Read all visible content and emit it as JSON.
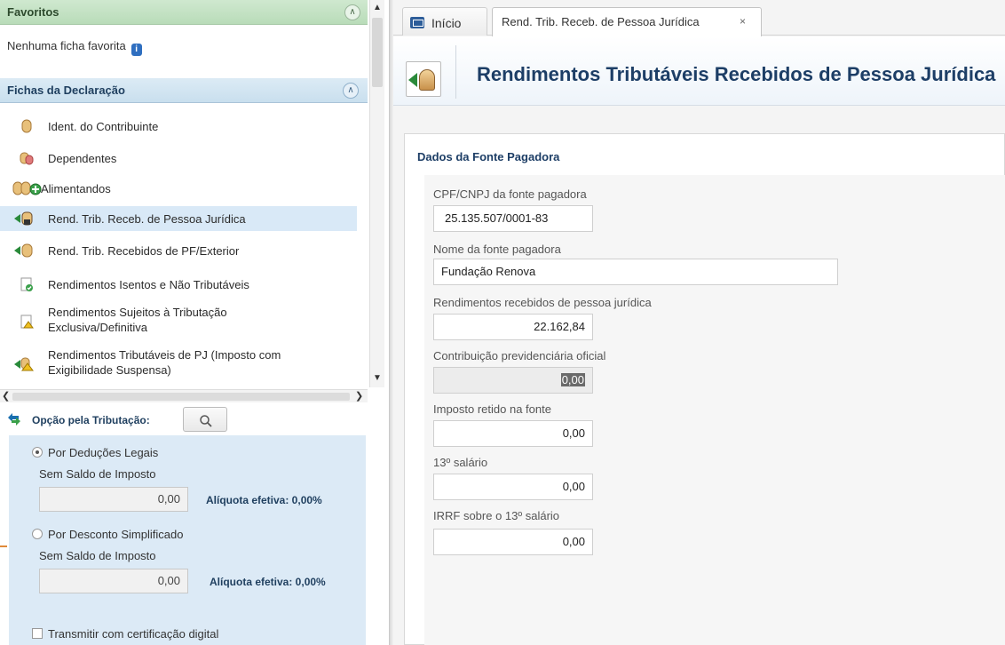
{
  "left": {
    "favoritos": {
      "title": "Favoritos",
      "empty_text": "Nenhuma ficha favorita"
    },
    "fichas": {
      "title": "Fichas da Declaração",
      "items": [
        {
          "label": "Ident. do Contribuinte",
          "icon": "person-icon"
        },
        {
          "label": "Dependentes",
          "icon": "dependents-icon"
        },
        {
          "label": "Alimentandos",
          "icon": "alimentandos-icon"
        },
        {
          "label": "Rend. Trib. Receb. de Pessoa Jurídica",
          "icon": "pj-income-icon"
        },
        {
          "label": "Rend. Trib. Recebidos de PF/Exterior",
          "icon": "pf-income-icon"
        },
        {
          "label": "Rendimentos Isentos e Não Tributáveis",
          "icon": "exempt-income-icon"
        },
        {
          "label_line1": "Rendimentos Sujeitos à Tributação",
          "label_line2": "Exclusiva/Definitiva",
          "icon": "exclusive-tax-icon"
        },
        {
          "label_line1": "Rendimentos Tributáveis de PJ (Imposto com",
          "label_line2": "Exigibilidade Suspensa)",
          "icon": "suspended-tax-icon"
        }
      ]
    },
    "opcao": {
      "label": "Opção pela Tributação:",
      "deducoes": {
        "label": "Por Deduções Legais",
        "saldo_label": "Sem Saldo de Imposto",
        "value": "0,00",
        "aliquota": "Alíquota efetiva: 0,00%"
      },
      "simplificado": {
        "label": "Por Desconto Simplificado",
        "saldo_label": "Sem Saldo de Imposto",
        "value": "0,00",
        "aliquota": "Alíquota efetiva: 0,00%"
      },
      "certificacao": "Transmitir com certificação digital"
    }
  },
  "tabs": [
    {
      "label": "Início"
    },
    {
      "label": "Rend. Trib. Receb. de Pessoa Jurídica",
      "close": "×"
    }
  ],
  "page_title": "Rendimentos Tributáveis Recebidos de Pessoa Jurídica",
  "form": {
    "section_title": "Dados da Fonte Pagadora",
    "fields": {
      "cpf_cnpj": {
        "label": "CPF/CNPJ da fonte pagadora",
        "value": "25.135.507/0001-83"
      },
      "nome": {
        "label": "Nome da fonte pagadora",
        "value": "Fundação Renova"
      },
      "rendimentos": {
        "label": "Rendimentos recebidos de pessoa jurídica",
        "value": "22.162,84"
      },
      "contribuicao": {
        "label": "Contribuição previdenciária oficial",
        "value": "0,00"
      },
      "imposto": {
        "label": "Imposto retido na fonte",
        "value": "0,00"
      },
      "decimo": {
        "label": "13º salário",
        "value": "0,00"
      },
      "irrf_decimo": {
        "label": "IRRF sobre o 13º salário",
        "value": "0,00"
      }
    }
  },
  "colors": {
    "accent_blue": "#1d3e66",
    "active_row": "#d9e9f7",
    "fav_header": "#cfe8cf",
    "tax_box": "#dceaf6"
  }
}
